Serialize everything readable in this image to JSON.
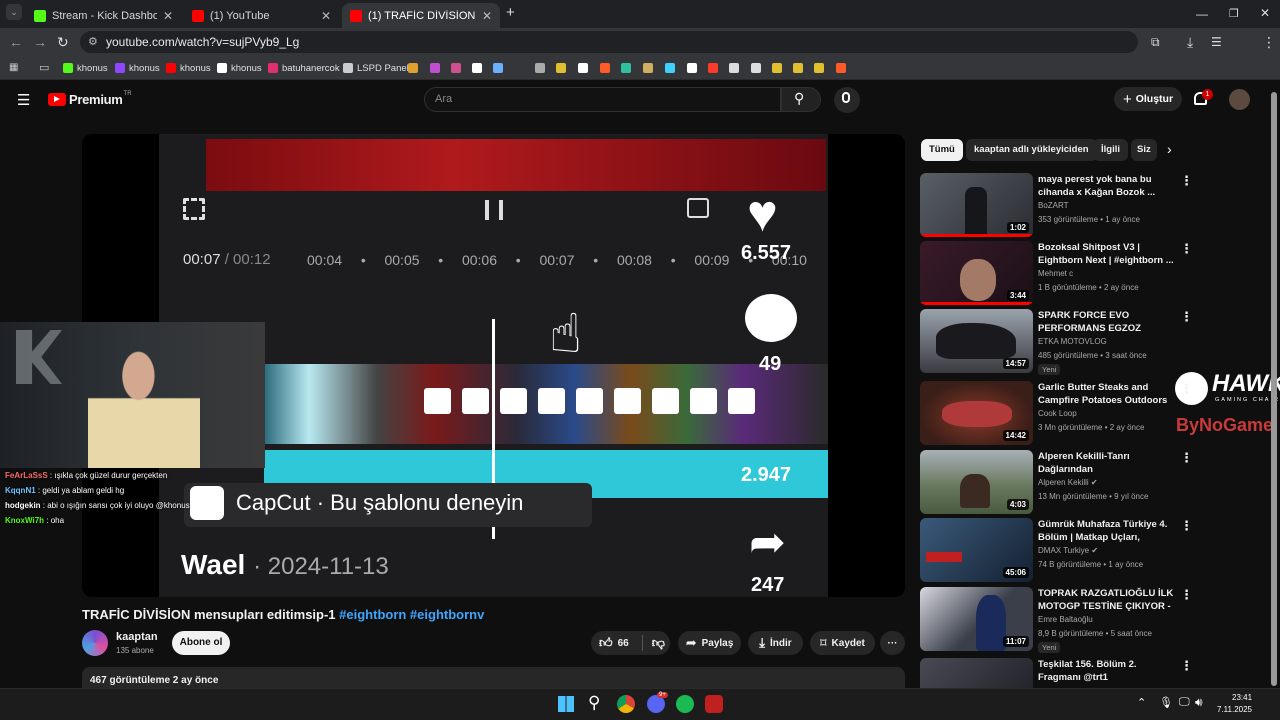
{
  "browser": {
    "tabs": [
      {
        "title": "Stream - Kick Dashboard",
        "favicon_color": "#53fc18"
      },
      {
        "title": "(1) YouTube",
        "favicon_color": "#ff0000"
      },
      {
        "title": "(1) TRAFİC DİVİSİON mensupları",
        "favicon_color": "#ff0000"
      }
    ],
    "new_tab": "+",
    "url": "youtube.com/watch?v=sujPVyb9_Lg",
    "bookmarks": [
      {
        "label": "khonus",
        "color": "#53fc18"
      },
      {
        "label": "khonus",
        "color": "#9146ff"
      },
      {
        "label": "khonus",
        "color": "#ff0000"
      },
      {
        "label": "khonus",
        "color": "#ffffff"
      },
      {
        "label": "batuhanercok",
        "color": "#e1306c"
      },
      {
        "label": "LSPD Panel",
        "color": "#cccccc"
      }
    ]
  },
  "youtube": {
    "logo": "Premium",
    "logo_sup": "TR",
    "search_placeholder": "Ara",
    "create_label": "Oluştur",
    "notif_count": "1"
  },
  "player": {
    "overlay": {
      "time_current": "00:07",
      "time_total": "/ 00:12",
      "ticks": [
        "00:04",
        "00:05",
        "00:06",
        "00:07",
        "00:08",
        "00:09",
        "00:10"
      ],
      "likes": "6.557",
      "comments": "49",
      "saves": "2.947",
      "shares": "247",
      "capcut": "CapCut · Bu şablonu deneyin",
      "author": "Wael",
      "date": "· 2024-11-13"
    },
    "side_logo_top": "HAWK",
    "side_logo_sub": "GAMING CHAIR",
    "side_logo_bottom": "ByNoGame"
  },
  "chat": [
    {
      "user": "FeArLaSsS",
      "msg": " : ışıkla çok güzel durur gerçekten",
      "color": "#ff6b6b"
    },
    {
      "user": "KqqnN1",
      "msg": " : geldi ya ablam geldi hg",
      "color": "#6ec6ff"
    },
    {
      "user": "hodgekin",
      "msg": " : abi o ışığın sansı çok iyi oluyo @khonus",
      "color": "#ffffff"
    },
    {
      "user": "KnoxWi7h",
      "msg": " : oha",
      "color": "#53fc18"
    }
  ],
  "video": {
    "title": "TRAFİC DİVİSİON mensupları editimsip-1 ",
    "tags": "#eightborn #eightbornv",
    "channel": "kaaptan",
    "subs": "135 abone",
    "subscribe": "Abone ol",
    "likes": "66",
    "share": "Paylaş",
    "download": "İndir",
    "save": "Kaydet",
    "more": "···",
    "views": "467 görüntüleme  2 ay önce"
  },
  "chips": [
    "Tümü",
    "kaaptan adlı yükleyiciden",
    "İlgili",
    "Siz"
  ],
  "recommendations": [
    {
      "title": "maya perest yok bana bu cihanda x Kağan Bozok ...",
      "channel": "BoZART",
      "meta": "353 görüntüleme • 1 ay önce",
      "duration": "1:02",
      "new": "",
      "thumb": "#3a3d42"
    },
    {
      "title": "Bozoksal Shitpost V3 | Eightborn Next | #eightborn ...",
      "channel": "Mehmet c",
      "meta": "1 B görüntüleme • 2 ay önce",
      "duration": "3:44",
      "new": "",
      "thumb": "#2a1f2a"
    },
    {
      "title": "SPARK FORCE EVO PERFORMANS EGZOZ TAKTI...",
      "channel": "ETKA MOTOVLOG",
      "meta": "485 görüntüleme • 3 saat önce",
      "duration": "14:57",
      "new": "Yeni",
      "thumb": "#4a4a52"
    },
    {
      "title": "Garlic Butter Steaks and Campfire Potatoes Outdoors",
      "channel": "Cook Loop",
      "meta": "3 Mn görüntüleme • 2 ay önce",
      "duration": "14:42",
      "new": "",
      "thumb": "#5a2a1e"
    },
    {
      "title": "Alperen Kekilli-Tanrı Dağlarından",
      "channel": "Alperen Kekilli ✔",
      "meta": "13 Mn görüntüleme • 9 yıl önce",
      "duration": "4:03",
      "new": "",
      "thumb": "#5d6a5a"
    },
    {
      "title": "Gümrük Muhafaza Türkiye 4. Bölüm | Matkap Uçları, Yasaklı...",
      "channel": "DMAX Turkiye ✔",
      "meta": "74 B görüntüleme • 1 ay önce",
      "duration": "45:06",
      "new": "",
      "thumb": "#23384a"
    },
    {
      "title": "TOPRAK RAZGATLIOĞLU İLK MOTOGP TESTİNE ÇIKIYOR - ...",
      "channel": "Emre Baltaoğlu",
      "meta": "8,9 B görüntüleme • 5 saat önce",
      "duration": "11:07",
      "new": "Yeni",
      "thumb": "#3d3f4a"
    },
    {
      "title": "Teşkilat 156. Bölüm 2. Fragmanı @trt1",
      "channel": "",
      "meta": "",
      "duration": "",
      "new": "",
      "thumb": "#2d2d33"
    }
  ],
  "taskbar": {
    "time": "23:41",
    "date": "7.11.2025",
    "discord_badge": "9+"
  }
}
